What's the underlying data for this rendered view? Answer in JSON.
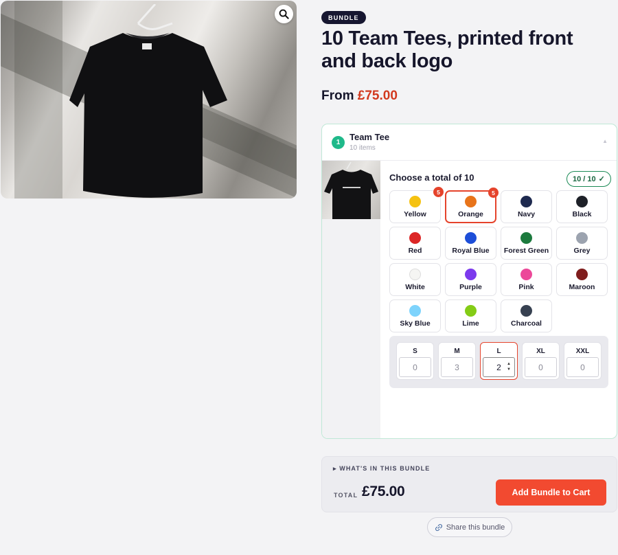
{
  "product": {
    "badge": "BUNDLE",
    "title": "10 Team Tees, printed front and back logo",
    "price_prefix": "From",
    "price": "£75.00"
  },
  "hero": {
    "zoom_icon": "magnifier-icon"
  },
  "step": {
    "number": "1",
    "title": "Team Tee",
    "subtitle": "10 items",
    "choose_label": "Choose a total of 10",
    "count": "10 / 10",
    "count_icon": "✓"
  },
  "colors": [
    {
      "name": "Yellow",
      "hex": "#f5c211",
      "qty": "5",
      "selected": false
    },
    {
      "name": "Orange",
      "hex": "#e8741a",
      "qty": "5",
      "selected": true
    },
    {
      "name": "Navy",
      "hex": "#1e2a4f",
      "qty": "",
      "selected": false
    },
    {
      "name": "Black",
      "hex": "#1e2128",
      "qty": "",
      "selected": false
    },
    {
      "name": "Red",
      "hex": "#dc2626",
      "qty": "",
      "selected": false
    },
    {
      "name": "Royal Blue",
      "hex": "#1d4ed8",
      "qty": "",
      "selected": false
    },
    {
      "name": "Forest Green",
      "hex": "#1c7a3e",
      "qty": "",
      "selected": false
    },
    {
      "name": "Grey",
      "hex": "#9ca3af",
      "qty": "",
      "selected": false
    },
    {
      "name": "White",
      "hex": "#f5f5f3",
      "qty": "",
      "selected": false
    },
    {
      "name": "Purple",
      "hex": "#7c3aed",
      "qty": "",
      "selected": false
    },
    {
      "name": "Pink",
      "hex": "#ec4899",
      "qty": "",
      "selected": false
    },
    {
      "name": "Maroon",
      "hex": "#7f1d1d",
      "qty": "",
      "selected": false
    },
    {
      "name": "Sky Blue",
      "hex": "#7dd3fc",
      "qty": "",
      "selected": false
    },
    {
      "name": "Lime",
      "hex": "#84cc16",
      "qty": "",
      "selected": false
    },
    {
      "name": "Charcoal",
      "hex": "#374151",
      "qty": "",
      "selected": false
    }
  ],
  "sizes": [
    {
      "label": "S",
      "value": "0"
    },
    {
      "label": "M",
      "value": "3"
    },
    {
      "label": "L",
      "value": "2"
    },
    {
      "label": "XL",
      "value": "0"
    },
    {
      "label": "XXL",
      "value": "0"
    }
  ],
  "summary": {
    "whats_in": "WHAT'S IN THIS BUNDLE",
    "whats_icon": "▸",
    "total_label": "TOTAL",
    "total": "£75.00",
    "cart_button": "Add Bundle to Cart"
  },
  "share": {
    "label": "Share this bundle",
    "icon": "link-icon"
  },
  "accent": "#f24a30"
}
